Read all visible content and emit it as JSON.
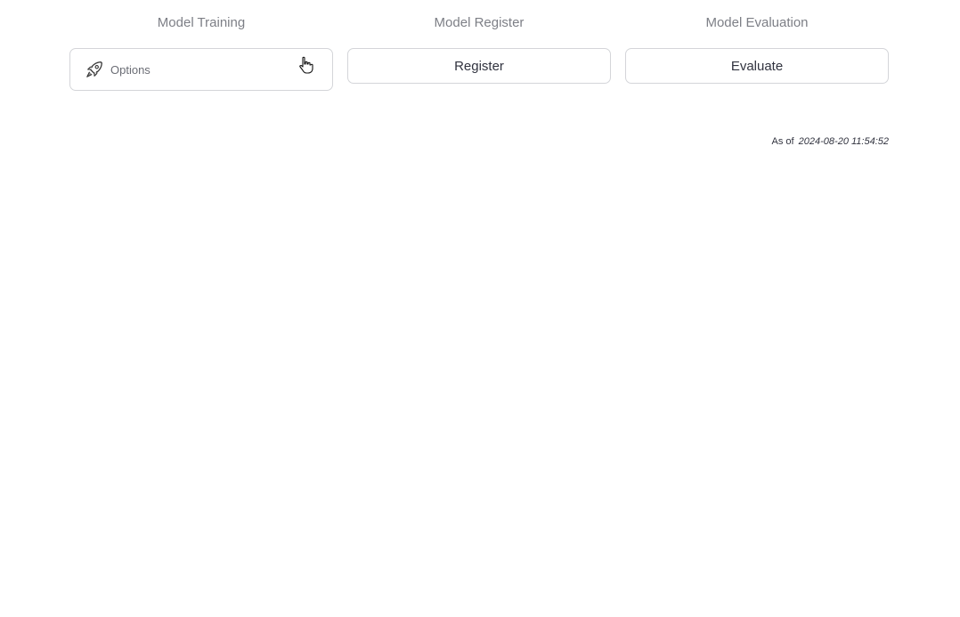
{
  "columns": [
    {
      "header": "Model Training",
      "button_label": "Options",
      "button_icon": "rocket-icon"
    },
    {
      "header": "Model Register",
      "button_label": "Register"
    },
    {
      "header": "Model Evaluation",
      "button_label": "Evaluate"
    }
  ],
  "timestamp": {
    "prefix": "As of",
    "value": "2024-08-20 11:54:52"
  }
}
